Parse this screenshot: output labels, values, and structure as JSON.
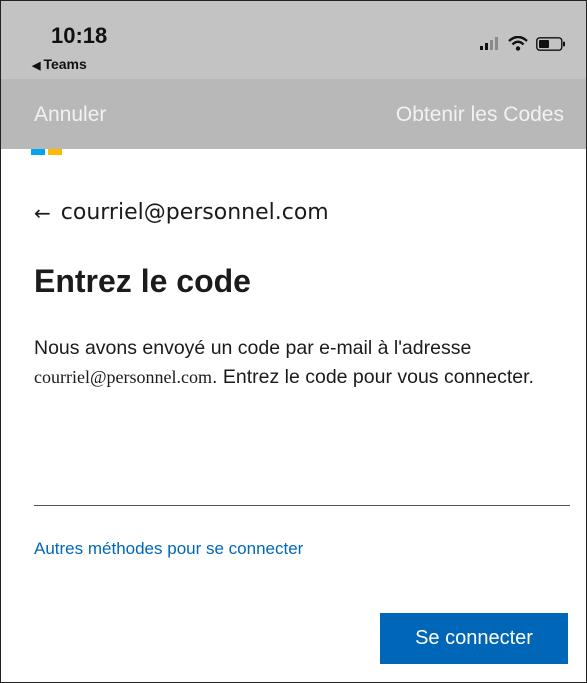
{
  "status_bar": {
    "time": "10:18",
    "back_app": "Teams",
    "back_glyph": "◀"
  },
  "nav": {
    "cancel_label": "Annuler",
    "get_codes_label": "Obtenir les Codes"
  },
  "brand": {
    "logo_colors": [
      "#00a4ef",
      "#ffb900"
    ]
  },
  "form": {
    "back_arrow": "←",
    "email": "courriel@personnel.com",
    "title": "Entrez le code",
    "desc_before": "Nous avons envoyé un code par e-mail à l'adresse ",
    "desc_email": "courriel@personnel.com",
    "desc_after": ". Entrez le code pour vous connecter.",
    "code_value": "",
    "other_methods_link": "Autres méthodes pour se connecter",
    "submit_label": "Se connecter"
  },
  "colors": {
    "accent": "#0067b8",
    "header_bg": "#b8b8b8"
  }
}
